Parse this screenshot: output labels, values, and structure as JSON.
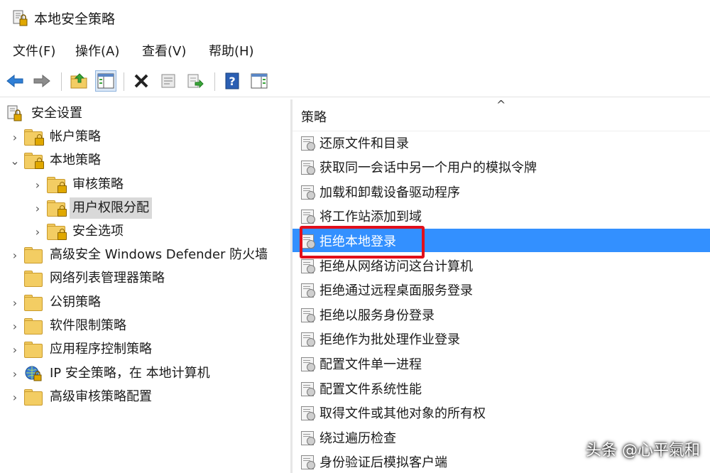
{
  "window": {
    "title": "本地安全策略"
  },
  "menu": [
    "文件(F)",
    "操作(A)",
    "查看(V)",
    "帮助(H)"
  ],
  "toolbar": {
    "buttons": [
      "back-arrow-icon",
      "forward-arrow-icon",
      "up-folder-icon",
      "show-hide-tree-icon",
      "delete-icon",
      "properties-icon",
      "export-list-icon",
      "help-icon",
      "show-hide-action-pane-icon"
    ]
  },
  "tree": {
    "root": "安全设置",
    "items": [
      {
        "label": "帐户策略",
        "expander": "›"
      },
      {
        "label": "本地策略",
        "expander": "⌄"
      },
      {
        "label": "审核策略",
        "expander": "›"
      },
      {
        "label": "用户权限分配",
        "expander": "›"
      },
      {
        "label": "安全选项",
        "expander": "›"
      },
      {
        "label": "高级安全 Windows Defender 防火墙",
        "expander": "›"
      },
      {
        "label": "网络列表管理器策略",
        "expander": ""
      },
      {
        "label": "公钥策略",
        "expander": "›"
      },
      {
        "label": "软件限制策略",
        "expander": "›"
      },
      {
        "label": "应用程序控制策略",
        "expander": "›"
      },
      {
        "label": "IP 安全策略，在 本地计算机",
        "expander": "›"
      },
      {
        "label": "高级审核策略配置",
        "expander": "›"
      }
    ]
  },
  "list": {
    "header": "策略",
    "sort_indicator": "^",
    "selected_color": "#3390ff",
    "items": [
      "还原文件和目录",
      "获取同一会话中另一个用户的模拟令牌",
      "加载和卸载设备驱动程序",
      "将工作站添加到域",
      "拒绝本地登录",
      "拒绝从网络访问这台计算机",
      "拒绝通过远程桌面服务登录",
      "拒绝以服务身份登录",
      "拒绝作为批处理作业登录",
      "配置文件单一进程",
      "配置文件系统性能",
      "取得文件或其他对象的所有权",
      "绕过遍历检查",
      "身份验证后模拟客户端"
    ]
  },
  "annotation": {
    "color": "#e10f1b"
  },
  "watermark": "头条 @心平氣和"
}
